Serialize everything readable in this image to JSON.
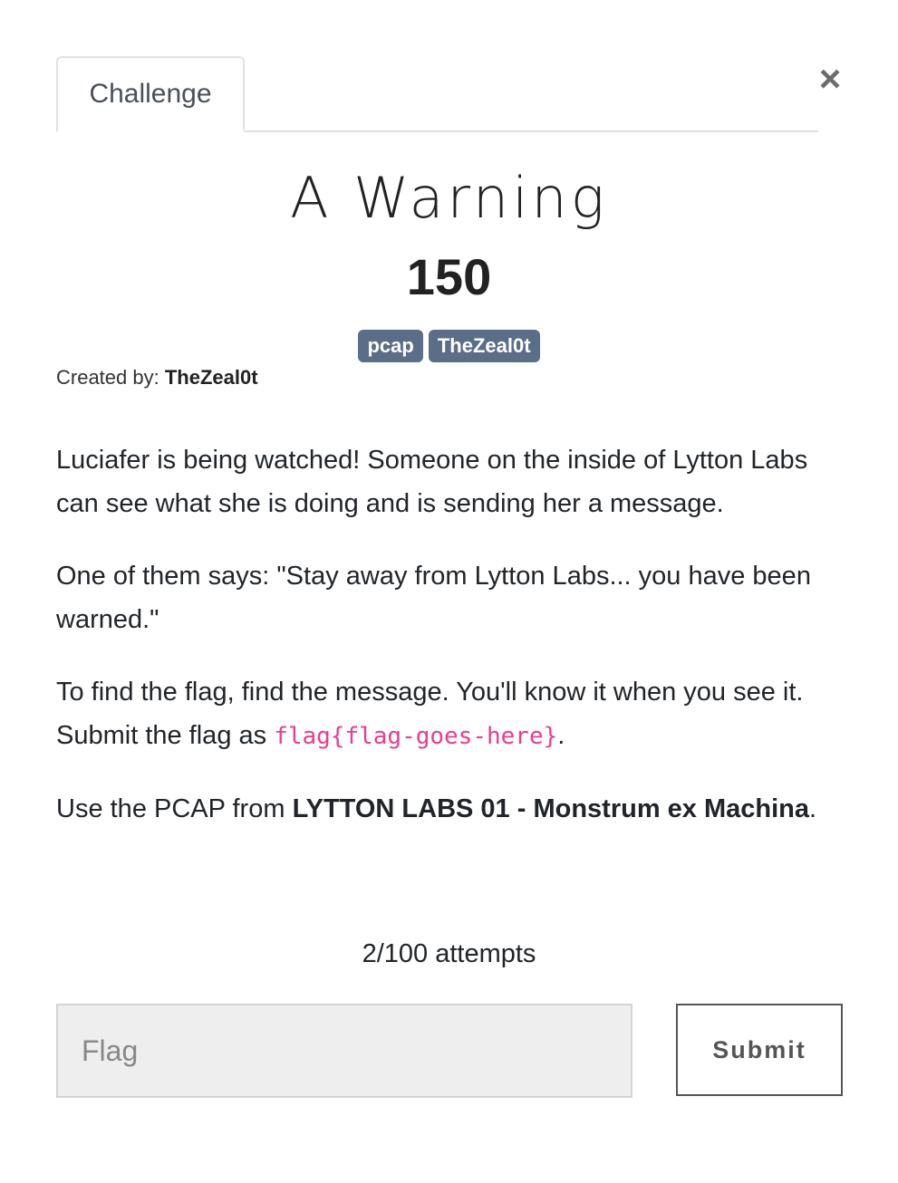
{
  "tabs": [
    {
      "label": "Challenge",
      "active": true
    }
  ],
  "close_label": "×",
  "challenge": {
    "name": "A Warning",
    "points": "150",
    "tags": [
      "pcap",
      "TheZeal0t"
    ],
    "created_by_label": "Created by:",
    "author": "TheZeal0t",
    "description": {
      "p1": "Luciafer is being watched! Someone on the inside of Lytton Labs can see what she is doing and is sending her a message.",
      "p2": "One of them says: \"Stay away from Lytton Labs... you have been warned.\"",
      "p3_before": "To find the flag, find the message. You'll know it when you see it. Submit the flag as ",
      "p3_code": "flag{flag-goes-here}",
      "p3_after": ".",
      "p4_before": "Use the PCAP from ",
      "p4_bold": "LYTTON LABS 01 - Monstrum ex Machina",
      "p4_after": "."
    }
  },
  "attempts": "2/100 attempts",
  "form": {
    "flag_placeholder": "Flag",
    "flag_value": "",
    "submit_label": "Submit"
  },
  "colors": {
    "tag_bg": "#5b6e87",
    "code_text": "#e83e8c",
    "input_bg": "#eeeeee"
  }
}
